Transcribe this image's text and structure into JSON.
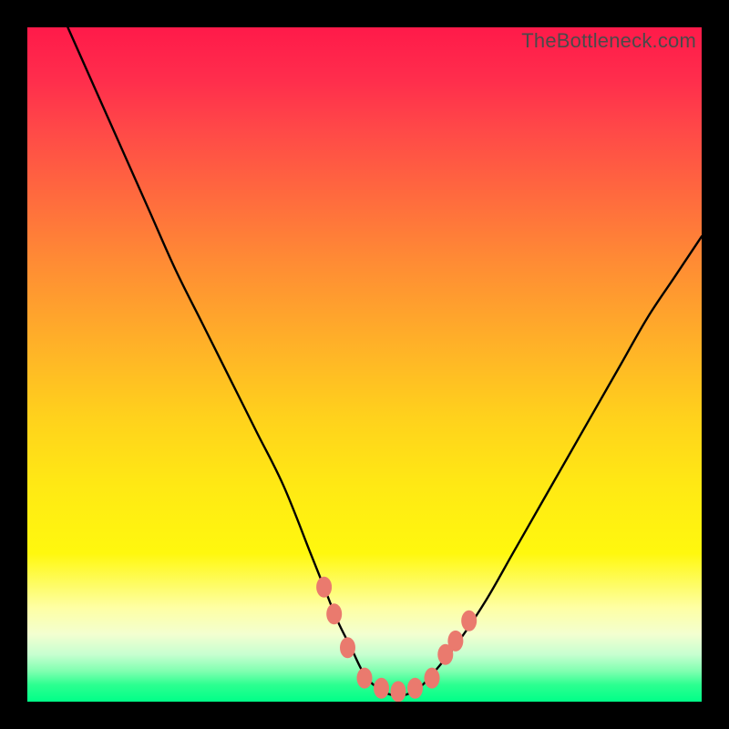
{
  "watermark": "TheBottleneck.com",
  "chart_data": {
    "type": "line",
    "title": "",
    "xlabel": "",
    "ylabel": "",
    "xlim": [
      0,
      100
    ],
    "ylim": [
      0,
      100
    ],
    "grid": false,
    "legend": false,
    "series": [
      {
        "name": "bottleneck-curve",
        "color": "#000000",
        "x": [
          6,
          10,
          14,
          18,
          22,
          26,
          30,
          34,
          38,
          42,
          44,
          46,
          48,
          50,
          52,
          54,
          56,
          58,
          60,
          64,
          68,
          72,
          76,
          80,
          84,
          88,
          92,
          96,
          100
        ],
        "y": [
          100,
          91,
          82,
          73,
          64,
          56,
          48,
          40,
          32,
          22,
          17,
          12,
          8,
          4,
          2,
          1,
          1,
          2,
          4,
          9,
          15,
          22,
          29,
          36,
          43,
          50,
          57,
          63,
          69
        ]
      }
    ],
    "markers": {
      "name": "optimal-range-markers",
      "color": "#ea7a6e",
      "points": [
        {
          "x": 44.0,
          "y": 17
        },
        {
          "x": 45.5,
          "y": 13
        },
        {
          "x": 47.5,
          "y": 8
        },
        {
          "x": 50.0,
          "y": 3.5
        },
        {
          "x": 52.5,
          "y": 2.0
        },
        {
          "x": 55.0,
          "y": 1.5
        },
        {
          "x": 57.5,
          "y": 2.0
        },
        {
          "x": 60.0,
          "y": 3.5
        },
        {
          "x": 62.0,
          "y": 7
        },
        {
          "x": 63.5,
          "y": 9
        },
        {
          "x": 65.5,
          "y": 12
        }
      ]
    },
    "gradient_stops": [
      {
        "pos": 0,
        "color": "#ff1a4a"
      },
      {
        "pos": 50,
        "color": "#ffd21c"
      },
      {
        "pos": 90,
        "color": "#feffa3"
      },
      {
        "pos": 100,
        "color": "#00ff88"
      }
    ]
  }
}
